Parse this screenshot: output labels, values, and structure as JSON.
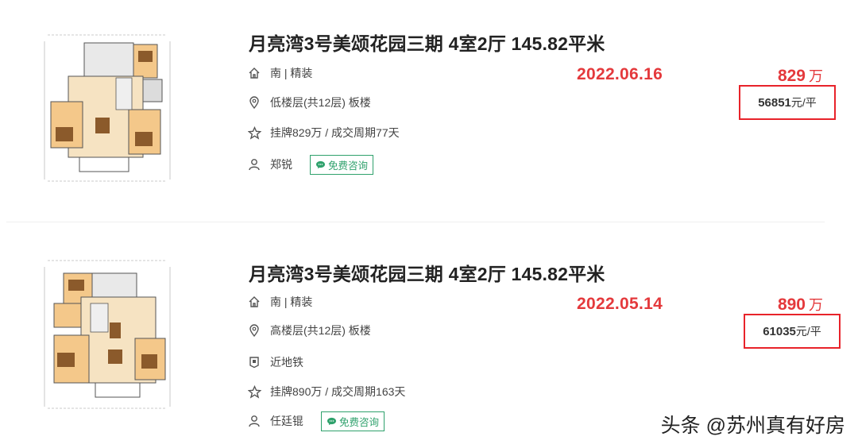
{
  "listings": [
    {
      "title": "月亮湾3号美颂花园三期 4室2厅 145.82平米",
      "orientation": "南 | 精装",
      "floor": "低楼层(共12层) 板楼",
      "listing_info": "挂牌829万 / 成交周期77天",
      "agent": "郑锐",
      "consult_label": "免费咨询",
      "deal_date": "2022.06.16",
      "total_price": "829",
      "total_unit": "万",
      "unit_price_num": "56851",
      "unit_price_suffix": "元/平"
    },
    {
      "title": "月亮湾3号美颂花园三期 4室2厅 145.82平米",
      "orientation": "南 | 精装",
      "floor": "高楼层(共12层) 板楼",
      "subway": "近地铁",
      "listing_info": "挂牌890万 / 成交周期163天",
      "agent": "任廷锟",
      "consult_label": "免费咨询",
      "deal_date": "2022.05.14",
      "total_price": "890",
      "total_unit": "万",
      "unit_price_num": "61035",
      "unit_price_suffix": "元/平"
    }
  ],
  "watermark": "头条 @苏州真有好房",
  "colors": {
    "accent_red": "#e4393c",
    "box_red": "#e8232a",
    "consult_green": "#2fa16c"
  },
  "icons": [
    "home-icon",
    "location-pin-icon",
    "star-icon",
    "person-icon",
    "subway-icon",
    "chat-bubble-icon"
  ]
}
